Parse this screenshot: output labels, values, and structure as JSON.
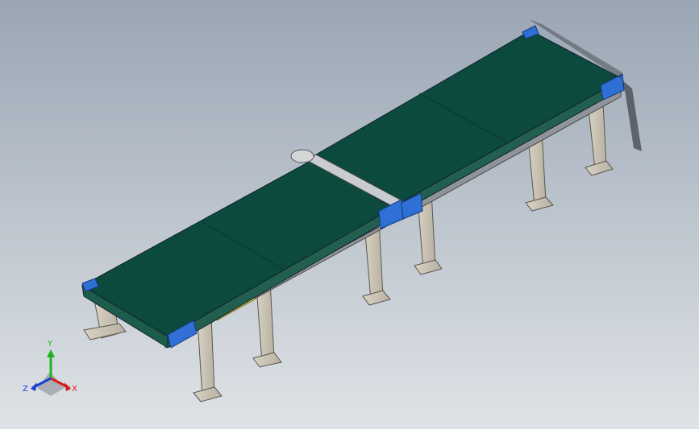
{
  "viewport": {
    "background_top": "#9aa6b4",
    "background_bottom": "#dfe3e7"
  },
  "model": {
    "belt_color": "#0b4a3c",
    "belt_edge_color": "#2f6b5a",
    "frame_color": "#b9bcc0",
    "leg_color": "#cfc8b8",
    "end_cap_color": "#2f6fd6",
    "guard_color": "#e8d23a"
  },
  "triad": {
    "x_label": "X",
    "y_label": "Y",
    "z_label": "Z",
    "x_color": "#d11f1f",
    "y_color": "#1fb41f",
    "z_color": "#1f3fd1"
  }
}
